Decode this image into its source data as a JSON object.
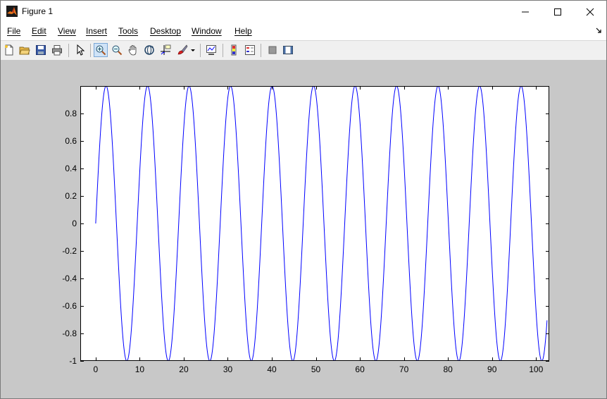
{
  "window": {
    "title": "Figure 1",
    "controls": [
      "minimize",
      "maximize",
      "close"
    ]
  },
  "menu": {
    "items": [
      "File",
      "Edit",
      "View",
      "Insert",
      "Tools",
      "Desktop",
      "Window",
      "Help"
    ]
  },
  "toolbar": {
    "buttons": [
      "new-figure",
      "open-file",
      "save-figure",
      "print-figure",
      "edit-plot",
      "zoom-in",
      "zoom-out",
      "pan",
      "rotate-3d",
      "data-cursor",
      "brush",
      "brush-dropdown",
      "link-plot",
      "insert-colorbar",
      "insert-legend",
      "hide-plot-tools",
      "show-plot-tools"
    ],
    "active": "zoom-in"
  },
  "colors": {
    "line": "#0000ff",
    "figure_background": "#c8c8c8",
    "axes_background": "#ffffff"
  },
  "chart_data": {
    "type": "line",
    "function": "y = sin(x / 1.5)",
    "x_start": 0,
    "x_end": 102.5,
    "xlim": [
      -3.5,
      103
    ],
    "ylim": [
      -1,
      1
    ],
    "xticks": [
      0,
      10,
      20,
      30,
      40,
      50,
      60,
      70,
      80,
      90,
      100
    ],
    "yticks": [
      -1,
      -0.8,
      -0.6,
      -0.4,
      -0.2,
      0,
      0.2,
      0.4,
      0.6,
      0.8
    ],
    "xtick_labels": [
      "0",
      "10",
      "20",
      "30",
      "40",
      "50",
      "60",
      "70",
      "80",
      "90",
      "100"
    ],
    "ytick_labels": [
      "-1",
      "-0.8",
      "-0.6",
      "-0.4",
      "-0.2",
      "0",
      "0.2",
      "0.4",
      "0.6",
      "0.8"
    ],
    "title": "",
    "xlabel": "",
    "ylabel": "",
    "grid": false,
    "legend": false
  }
}
